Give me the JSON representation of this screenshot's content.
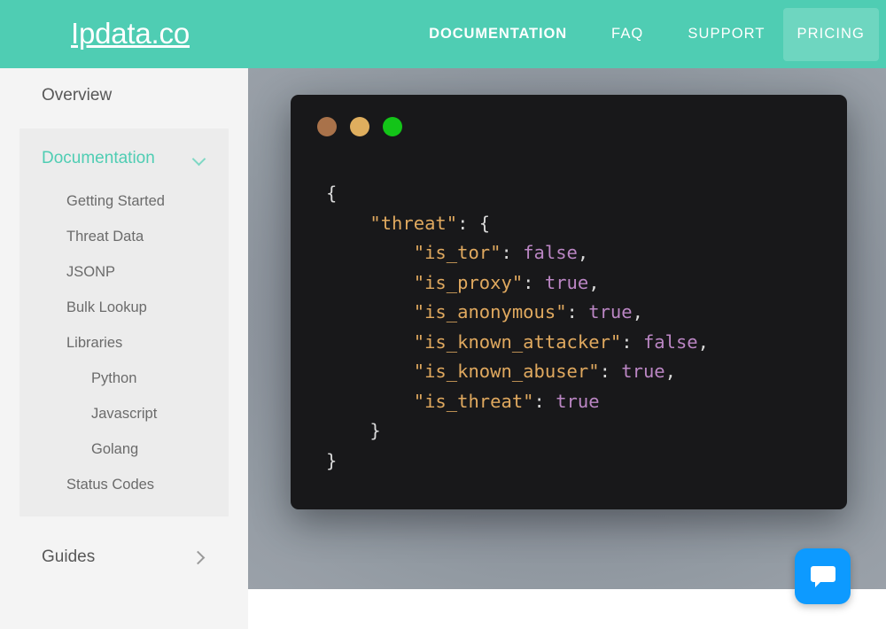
{
  "header": {
    "brand": "Ipdata.co",
    "nav": [
      {
        "label": "DOCUMENTATION",
        "active": true,
        "boxed": false
      },
      {
        "label": "FAQ",
        "active": false,
        "boxed": false
      },
      {
        "label": "SUPPORT",
        "active": false,
        "boxed": false
      },
      {
        "label": "PRICING",
        "active": false,
        "boxed": true
      }
    ],
    "colors": {
      "background": "#4fcdb3",
      "text": "#ffffff",
      "boxed_background": "rgba(255,255,255,0.18)"
    }
  },
  "sidebar": {
    "background": "#f4f4f4",
    "overview": {
      "label": "Overview"
    },
    "documentation": {
      "label": "Documentation",
      "accent_color": "#4fcdb3",
      "panel_background": "#ececec",
      "toggle_icon": "chevron-down-icon",
      "expanded": true,
      "items": [
        {
          "label": "Getting Started",
          "level": 1
        },
        {
          "label": "Threat Data",
          "level": 1
        },
        {
          "label": "JSONP",
          "level": 1
        },
        {
          "label": "Bulk Lookup",
          "level": 1
        },
        {
          "label": "Libraries",
          "level": 1
        },
        {
          "label": "Python",
          "level": 2
        },
        {
          "label": "Javascript",
          "level": 2
        },
        {
          "label": "Golang",
          "level": 2
        },
        {
          "label": "Status Codes",
          "level": 1
        }
      ]
    },
    "guides": {
      "label": "Guides",
      "toggle_icon": "chevron-right-icon",
      "expanded": false
    }
  },
  "hero": {
    "background_color": "#8b929b",
    "code_window": {
      "background": "#18181a",
      "dots": [
        {
          "name": "close-dot",
          "color": "#a9724a"
        },
        {
          "name": "minimize-dot",
          "color": "#dfae5e"
        },
        {
          "name": "maximize-dot",
          "color": "#13c418"
        }
      ],
      "language": "json",
      "token_colors": {
        "key": "#e0a95f",
        "boolean": "#bb86c4",
        "punctuation": "#d9d9d9"
      },
      "lines": [
        [
          {
            "t": "{",
            "c": "punct"
          }
        ],
        [
          {
            "t": "    ",
            "c": "punct"
          },
          {
            "t": "\"threat\"",
            "c": "key"
          },
          {
            "t": ": {",
            "c": "punct"
          }
        ],
        [
          {
            "t": "        ",
            "c": "punct"
          },
          {
            "t": "\"is_tor\"",
            "c": "key"
          },
          {
            "t": ": ",
            "c": "punct"
          },
          {
            "t": "false",
            "c": "bool"
          },
          {
            "t": ",",
            "c": "punct"
          }
        ],
        [
          {
            "t": "        ",
            "c": "punct"
          },
          {
            "t": "\"is_proxy\"",
            "c": "key"
          },
          {
            "t": ": ",
            "c": "punct"
          },
          {
            "t": "true",
            "c": "bool"
          },
          {
            "t": ",",
            "c": "punct"
          }
        ],
        [
          {
            "t": "        ",
            "c": "punct"
          },
          {
            "t": "\"is_anonymous\"",
            "c": "key"
          },
          {
            "t": ": ",
            "c": "punct"
          },
          {
            "t": "true",
            "c": "bool"
          },
          {
            "t": ",",
            "c": "punct"
          }
        ],
        [
          {
            "t": "        ",
            "c": "punct"
          },
          {
            "t": "\"is_known_attacker\"",
            "c": "key"
          },
          {
            "t": ": ",
            "c": "punct"
          },
          {
            "t": "false",
            "c": "bool"
          },
          {
            "t": ",",
            "c": "punct"
          }
        ],
        [
          {
            "t": "        ",
            "c": "punct"
          },
          {
            "t": "\"is_known_abuser\"",
            "c": "key"
          },
          {
            "t": ": ",
            "c": "punct"
          },
          {
            "t": "true",
            "c": "bool"
          },
          {
            "t": ",",
            "c": "punct"
          }
        ],
        [
          {
            "t": "        ",
            "c": "punct"
          },
          {
            "t": "\"is_threat\"",
            "c": "key"
          },
          {
            "t": ": ",
            "c": "punct"
          },
          {
            "t": "true",
            "c": "bool"
          }
        ],
        [
          {
            "t": "    }",
            "c": "punct"
          }
        ],
        [
          {
            "t": "}",
            "c": "punct"
          }
        ]
      ]
    }
  },
  "chat_widget": {
    "icon": "chat-bubble-icon",
    "background_color": "#0d9aff",
    "icon_color": "#ffffff"
  }
}
